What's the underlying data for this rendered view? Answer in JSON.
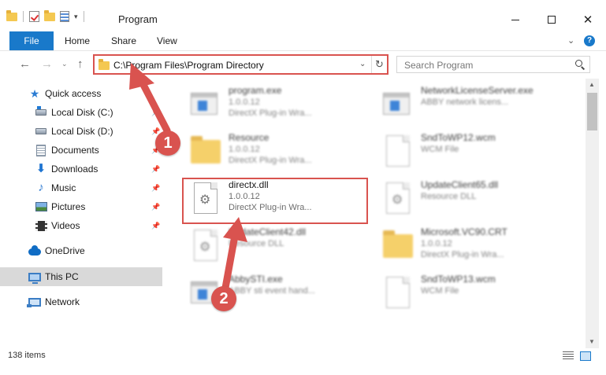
{
  "window": {
    "title": "Program",
    "minimize_glyph": "—",
    "close_glyph": "✕"
  },
  "ribbon": {
    "tabs": [
      "File",
      "Home",
      "Share",
      "View"
    ],
    "help_glyph": "?",
    "collapse_glyph": "⌄"
  },
  "navigation": {
    "back_glyph": "←",
    "forward_glyph": "→",
    "history_glyph": "⌄",
    "up_glyph": "↑",
    "address_path": "C:\\Program Files\\Program Directory",
    "address_dropdown_glyph": "⌄",
    "refresh_glyph": "↻",
    "search_placeholder": "Search Program"
  },
  "sidebar": {
    "items": [
      {
        "label": "Quick access",
        "icon": "star-icon"
      },
      {
        "label": "Local Disk (C:)",
        "icon": "drive-icon"
      },
      {
        "label": "Local Disk (D:)",
        "icon": "drive-icon"
      },
      {
        "label": "Documents",
        "icon": "documents-icon"
      },
      {
        "label": "Downloads",
        "icon": "downloads-icon"
      },
      {
        "label": "Music",
        "icon": "music-icon"
      },
      {
        "label": "Pictures",
        "icon": "pictures-icon"
      },
      {
        "label": "Videos",
        "icon": "videos-icon"
      },
      {
        "label": "OneDrive",
        "icon": "onedrive-icon"
      },
      {
        "label": "This PC",
        "icon": "this-pc-icon"
      },
      {
        "label": "Network",
        "icon": "network-icon"
      }
    ],
    "selected": "This PC",
    "pin_glyph": "📌"
  },
  "files": [
    {
      "name": "program.exe",
      "line2": "1.0.0.12",
      "line3": "DirectX Plug-in Wra...",
      "icon": "exe-icon"
    },
    {
      "name": "Resource",
      "line2": "1.0.0.12",
      "line3": "DirectX Plug-in Wra...",
      "icon": "folder-icon"
    },
    {
      "name": "directx.dll",
      "line2": "1.0.0.12",
      "line3": "DirectX Plug-in Wra...",
      "icon": "dll-icon"
    },
    {
      "name": "UpdateClient42.dll",
      "line2": "Resource DLL",
      "line3": "",
      "icon": "dll-icon"
    },
    {
      "name": "AbbySTI.exe",
      "line2": "ABBY sti event hand...",
      "line3": "",
      "icon": "exe-icon"
    },
    {
      "name": "NetworkLicenseServer.exe",
      "line2": "ABBY network licens...",
      "line3": "",
      "icon": "exe-icon"
    },
    {
      "name": "SndToWP12.wcm",
      "line2": "WCM File",
      "line3": "",
      "icon": "file-icon"
    },
    {
      "name": "UpdateClient65.dll",
      "line2": "Resource DLL",
      "line3": "",
      "icon": "dll-icon"
    },
    {
      "name": "Microsoft.VC90.CRT",
      "line2": "1.0.0.12",
      "line3": "DirectX Plug-in Wra...",
      "icon": "folder-icon"
    },
    {
      "name": "SndToWP13.wcm",
      "line2": "WCM File",
      "line3": "",
      "icon": "file-icon"
    }
  ],
  "gear_glyph": "⚙",
  "status": {
    "item_count": "138 items"
  },
  "annotations": {
    "callout_1": "1",
    "callout_2": "2",
    "accent_color": "#d9534f"
  },
  "colors": {
    "file_tab": "#1979ca",
    "selection": "#d9d9d9",
    "annotation": "#d9534f"
  }
}
